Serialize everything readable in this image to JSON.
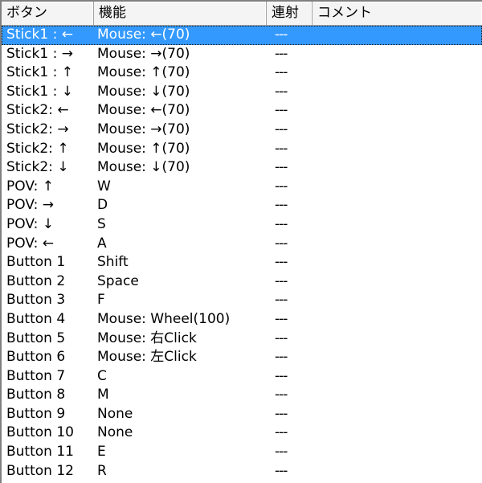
{
  "columns": {
    "button": "ボタン",
    "function": "機能",
    "rapid": "連射",
    "comment": "コメント"
  },
  "colors": {
    "selection": "#3399ff",
    "header_bg": "#f4f4f4"
  },
  "rows": [
    {
      "button": "Stick1 : ←",
      "function": "Mouse: ←(70)",
      "rapid": "---",
      "comment": "",
      "selected": true
    },
    {
      "button": "Stick1 : →",
      "function": "Mouse: →(70)",
      "rapid": "---",
      "comment": ""
    },
    {
      "button": "Stick1 : ↑",
      "function": "Mouse: ↑(70)",
      "rapid": "---",
      "comment": ""
    },
    {
      "button": "Stick1 : ↓",
      "function": "Mouse: ↓(70)",
      "rapid": "---",
      "comment": ""
    },
    {
      "button": "Stick2: ←",
      "function": "Mouse: ←(70)",
      "rapid": "---",
      "comment": ""
    },
    {
      "button": "Stick2: →",
      "function": "Mouse: →(70)",
      "rapid": "---",
      "comment": ""
    },
    {
      "button": "Stick2: ↑",
      "function": "Mouse: ↑(70)",
      "rapid": "---",
      "comment": ""
    },
    {
      "button": "Stick2: ↓",
      "function": "Mouse: ↓(70)",
      "rapid": "---",
      "comment": ""
    },
    {
      "button": "POV: ↑",
      "function": "W",
      "rapid": "---",
      "comment": ""
    },
    {
      "button": "POV: →",
      "function": "D",
      "rapid": "---",
      "comment": ""
    },
    {
      "button": "POV: ↓",
      "function": "S",
      "rapid": "---",
      "comment": ""
    },
    {
      "button": "POV: ←",
      "function": "A",
      "rapid": "---",
      "comment": ""
    },
    {
      "button": "Button 1",
      "function": "Shift",
      "rapid": "---",
      "comment": ""
    },
    {
      "button": "Button 2",
      "function": "Space",
      "rapid": "---",
      "comment": ""
    },
    {
      "button": "Button 3",
      "function": "F",
      "rapid": "---",
      "comment": ""
    },
    {
      "button": "Button 4",
      "function": "Mouse: Wheel(100)",
      "rapid": "---",
      "comment": ""
    },
    {
      "button": "Button 5",
      "function": "Mouse: 右Click",
      "rapid": "---",
      "comment": ""
    },
    {
      "button": "Button 6",
      "function": "Mouse: 左Click",
      "rapid": "---",
      "comment": ""
    },
    {
      "button": "Button 7",
      "function": "C",
      "rapid": "---",
      "comment": ""
    },
    {
      "button": "Button 8",
      "function": "M",
      "rapid": "---",
      "comment": ""
    },
    {
      "button": "Button 9",
      "function": "None",
      "rapid": "---",
      "comment": ""
    },
    {
      "button": "Button 10",
      "function": "None",
      "rapid": "---",
      "comment": ""
    },
    {
      "button": "Button 11",
      "function": "E",
      "rapid": "---",
      "comment": ""
    },
    {
      "button": "Button 12",
      "function": "R",
      "rapid": "---",
      "comment": ""
    }
  ]
}
